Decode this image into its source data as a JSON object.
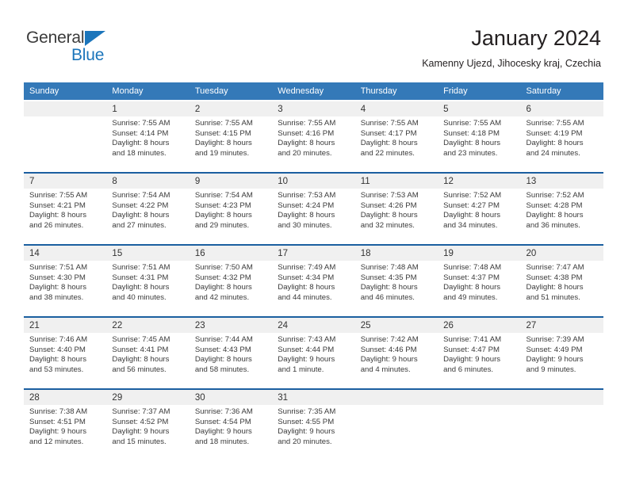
{
  "brand": {
    "name_part1": "General",
    "name_part2": "Blue",
    "primary_color": "#1b75bb",
    "header_color": "#3479b8",
    "separator_color": "#1b5fa0",
    "daynum_band_color": "#f0f0f0"
  },
  "header": {
    "title": "January 2024",
    "subtitle": "Kamenny Ujezd, Jihocesky kraj, Czechia"
  },
  "weekdays": [
    "Sunday",
    "Monday",
    "Tuesday",
    "Wednesday",
    "Thursday",
    "Friday",
    "Saturday"
  ],
  "weeks": [
    {
      "days": [
        {
          "num": "",
          "sunrise": "",
          "sunset": "",
          "daylight1": "",
          "daylight2": ""
        },
        {
          "num": "1",
          "sunrise": "Sunrise: 7:55 AM",
          "sunset": "Sunset: 4:14 PM",
          "daylight1": "Daylight: 8 hours",
          "daylight2": "and 18 minutes."
        },
        {
          "num": "2",
          "sunrise": "Sunrise: 7:55 AM",
          "sunset": "Sunset: 4:15 PM",
          "daylight1": "Daylight: 8 hours",
          "daylight2": "and 19 minutes."
        },
        {
          "num": "3",
          "sunrise": "Sunrise: 7:55 AM",
          "sunset": "Sunset: 4:16 PM",
          "daylight1": "Daylight: 8 hours",
          "daylight2": "and 20 minutes."
        },
        {
          "num": "4",
          "sunrise": "Sunrise: 7:55 AM",
          "sunset": "Sunset: 4:17 PM",
          "daylight1": "Daylight: 8 hours",
          "daylight2": "and 22 minutes."
        },
        {
          "num": "5",
          "sunrise": "Sunrise: 7:55 AM",
          "sunset": "Sunset: 4:18 PM",
          "daylight1": "Daylight: 8 hours",
          "daylight2": "and 23 minutes."
        },
        {
          "num": "6",
          "sunrise": "Sunrise: 7:55 AM",
          "sunset": "Sunset: 4:19 PM",
          "daylight1": "Daylight: 8 hours",
          "daylight2": "and 24 minutes."
        }
      ]
    },
    {
      "days": [
        {
          "num": "7",
          "sunrise": "Sunrise: 7:55 AM",
          "sunset": "Sunset: 4:21 PM",
          "daylight1": "Daylight: 8 hours",
          "daylight2": "and 26 minutes."
        },
        {
          "num": "8",
          "sunrise": "Sunrise: 7:54 AM",
          "sunset": "Sunset: 4:22 PM",
          "daylight1": "Daylight: 8 hours",
          "daylight2": "and 27 minutes."
        },
        {
          "num": "9",
          "sunrise": "Sunrise: 7:54 AM",
          "sunset": "Sunset: 4:23 PM",
          "daylight1": "Daylight: 8 hours",
          "daylight2": "and 29 minutes."
        },
        {
          "num": "10",
          "sunrise": "Sunrise: 7:53 AM",
          "sunset": "Sunset: 4:24 PM",
          "daylight1": "Daylight: 8 hours",
          "daylight2": "and 30 minutes."
        },
        {
          "num": "11",
          "sunrise": "Sunrise: 7:53 AM",
          "sunset": "Sunset: 4:26 PM",
          "daylight1": "Daylight: 8 hours",
          "daylight2": "and 32 minutes."
        },
        {
          "num": "12",
          "sunrise": "Sunrise: 7:52 AM",
          "sunset": "Sunset: 4:27 PM",
          "daylight1": "Daylight: 8 hours",
          "daylight2": "and 34 minutes."
        },
        {
          "num": "13",
          "sunrise": "Sunrise: 7:52 AM",
          "sunset": "Sunset: 4:28 PM",
          "daylight1": "Daylight: 8 hours",
          "daylight2": "and 36 minutes."
        }
      ]
    },
    {
      "days": [
        {
          "num": "14",
          "sunrise": "Sunrise: 7:51 AM",
          "sunset": "Sunset: 4:30 PM",
          "daylight1": "Daylight: 8 hours",
          "daylight2": "and 38 minutes."
        },
        {
          "num": "15",
          "sunrise": "Sunrise: 7:51 AM",
          "sunset": "Sunset: 4:31 PM",
          "daylight1": "Daylight: 8 hours",
          "daylight2": "and 40 minutes."
        },
        {
          "num": "16",
          "sunrise": "Sunrise: 7:50 AM",
          "sunset": "Sunset: 4:32 PM",
          "daylight1": "Daylight: 8 hours",
          "daylight2": "and 42 minutes."
        },
        {
          "num": "17",
          "sunrise": "Sunrise: 7:49 AM",
          "sunset": "Sunset: 4:34 PM",
          "daylight1": "Daylight: 8 hours",
          "daylight2": "and 44 minutes."
        },
        {
          "num": "18",
          "sunrise": "Sunrise: 7:48 AM",
          "sunset": "Sunset: 4:35 PM",
          "daylight1": "Daylight: 8 hours",
          "daylight2": "and 46 minutes."
        },
        {
          "num": "19",
          "sunrise": "Sunrise: 7:48 AM",
          "sunset": "Sunset: 4:37 PM",
          "daylight1": "Daylight: 8 hours",
          "daylight2": "and 49 minutes."
        },
        {
          "num": "20",
          "sunrise": "Sunrise: 7:47 AM",
          "sunset": "Sunset: 4:38 PM",
          "daylight1": "Daylight: 8 hours",
          "daylight2": "and 51 minutes."
        }
      ]
    },
    {
      "days": [
        {
          "num": "21",
          "sunrise": "Sunrise: 7:46 AM",
          "sunset": "Sunset: 4:40 PM",
          "daylight1": "Daylight: 8 hours",
          "daylight2": "and 53 minutes."
        },
        {
          "num": "22",
          "sunrise": "Sunrise: 7:45 AM",
          "sunset": "Sunset: 4:41 PM",
          "daylight1": "Daylight: 8 hours",
          "daylight2": "and 56 minutes."
        },
        {
          "num": "23",
          "sunrise": "Sunrise: 7:44 AM",
          "sunset": "Sunset: 4:43 PM",
          "daylight1": "Daylight: 8 hours",
          "daylight2": "and 58 minutes."
        },
        {
          "num": "24",
          "sunrise": "Sunrise: 7:43 AM",
          "sunset": "Sunset: 4:44 PM",
          "daylight1": "Daylight: 9 hours",
          "daylight2": "and 1 minute."
        },
        {
          "num": "25",
          "sunrise": "Sunrise: 7:42 AM",
          "sunset": "Sunset: 4:46 PM",
          "daylight1": "Daylight: 9 hours",
          "daylight2": "and 4 minutes."
        },
        {
          "num": "26",
          "sunrise": "Sunrise: 7:41 AM",
          "sunset": "Sunset: 4:47 PM",
          "daylight1": "Daylight: 9 hours",
          "daylight2": "and 6 minutes."
        },
        {
          "num": "27",
          "sunrise": "Sunrise: 7:39 AM",
          "sunset": "Sunset: 4:49 PM",
          "daylight1": "Daylight: 9 hours",
          "daylight2": "and 9 minutes."
        }
      ]
    },
    {
      "days": [
        {
          "num": "28",
          "sunrise": "Sunrise: 7:38 AM",
          "sunset": "Sunset: 4:51 PM",
          "daylight1": "Daylight: 9 hours",
          "daylight2": "and 12 minutes."
        },
        {
          "num": "29",
          "sunrise": "Sunrise: 7:37 AM",
          "sunset": "Sunset: 4:52 PM",
          "daylight1": "Daylight: 9 hours",
          "daylight2": "and 15 minutes."
        },
        {
          "num": "30",
          "sunrise": "Sunrise: 7:36 AM",
          "sunset": "Sunset: 4:54 PM",
          "daylight1": "Daylight: 9 hours",
          "daylight2": "and 18 minutes."
        },
        {
          "num": "31",
          "sunrise": "Sunrise: 7:35 AM",
          "sunset": "Sunset: 4:55 PM",
          "daylight1": "Daylight: 9 hours",
          "daylight2": "and 20 minutes."
        },
        {
          "num": "",
          "sunrise": "",
          "sunset": "",
          "daylight1": "",
          "daylight2": ""
        },
        {
          "num": "",
          "sunrise": "",
          "sunset": "",
          "daylight1": "",
          "daylight2": ""
        },
        {
          "num": "",
          "sunrise": "",
          "sunset": "",
          "daylight1": "",
          "daylight2": ""
        }
      ]
    }
  ]
}
